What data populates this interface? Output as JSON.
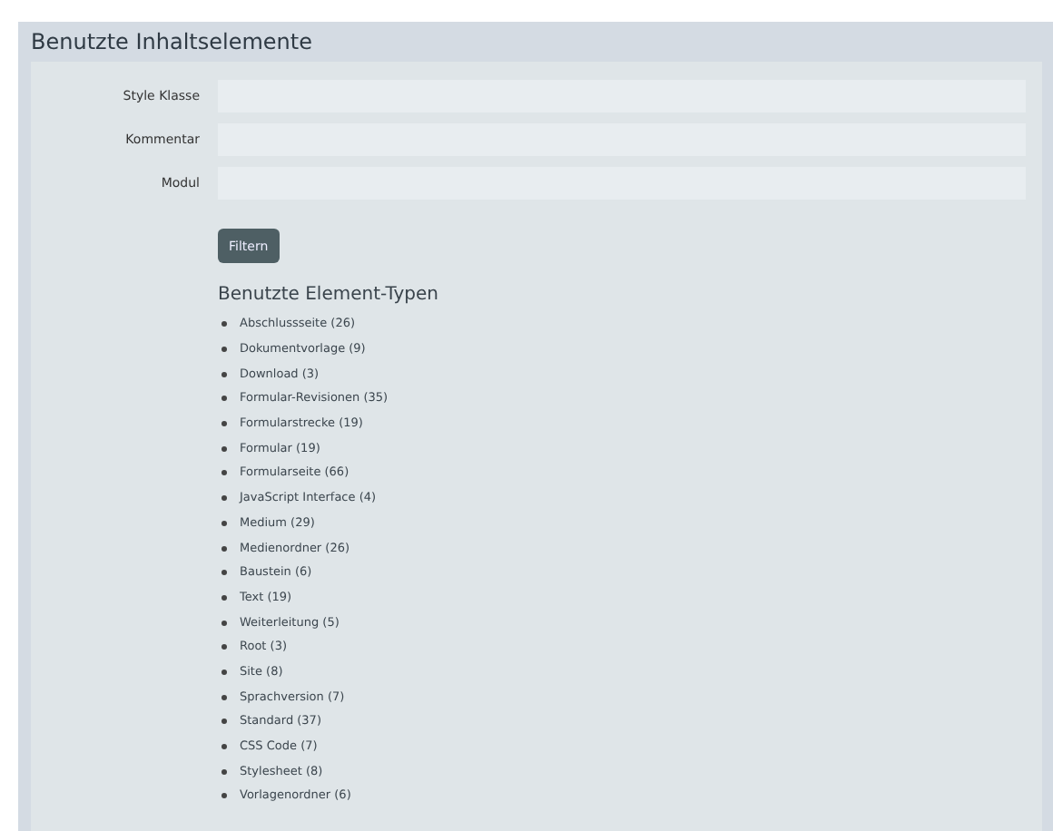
{
  "panel": {
    "title": "Benutzte Inhaltselemente"
  },
  "fields": [
    {
      "label": "Style Klasse"
    },
    {
      "label": "Kommentar"
    },
    {
      "label": "Modul"
    }
  ],
  "button": "Filtern",
  "types": {
    "heading": "Benutzte Element-Typen",
    "items": [
      "Abschlussseite (26)",
      "Dokumentvorlage (9)",
      "Download (3)",
      "Formular-Revisionen (35)",
      "Formularstrecke (19)",
      "Formular (19)",
      "Formularseite (66)",
      "JavaScript Interface (4)",
      "Medium (29)",
      "Medienordner (26)",
      "Baustein (6)",
      "Text (19)",
      "Weiterleitung (5)",
      "Root (3)",
      "Site (8)",
      "Sprachversion (7)",
      "Standard (37)",
      "CSS Code (7)",
      "Stylesheet (8)",
      "Vorlagenordner (6)"
    ]
  }
}
